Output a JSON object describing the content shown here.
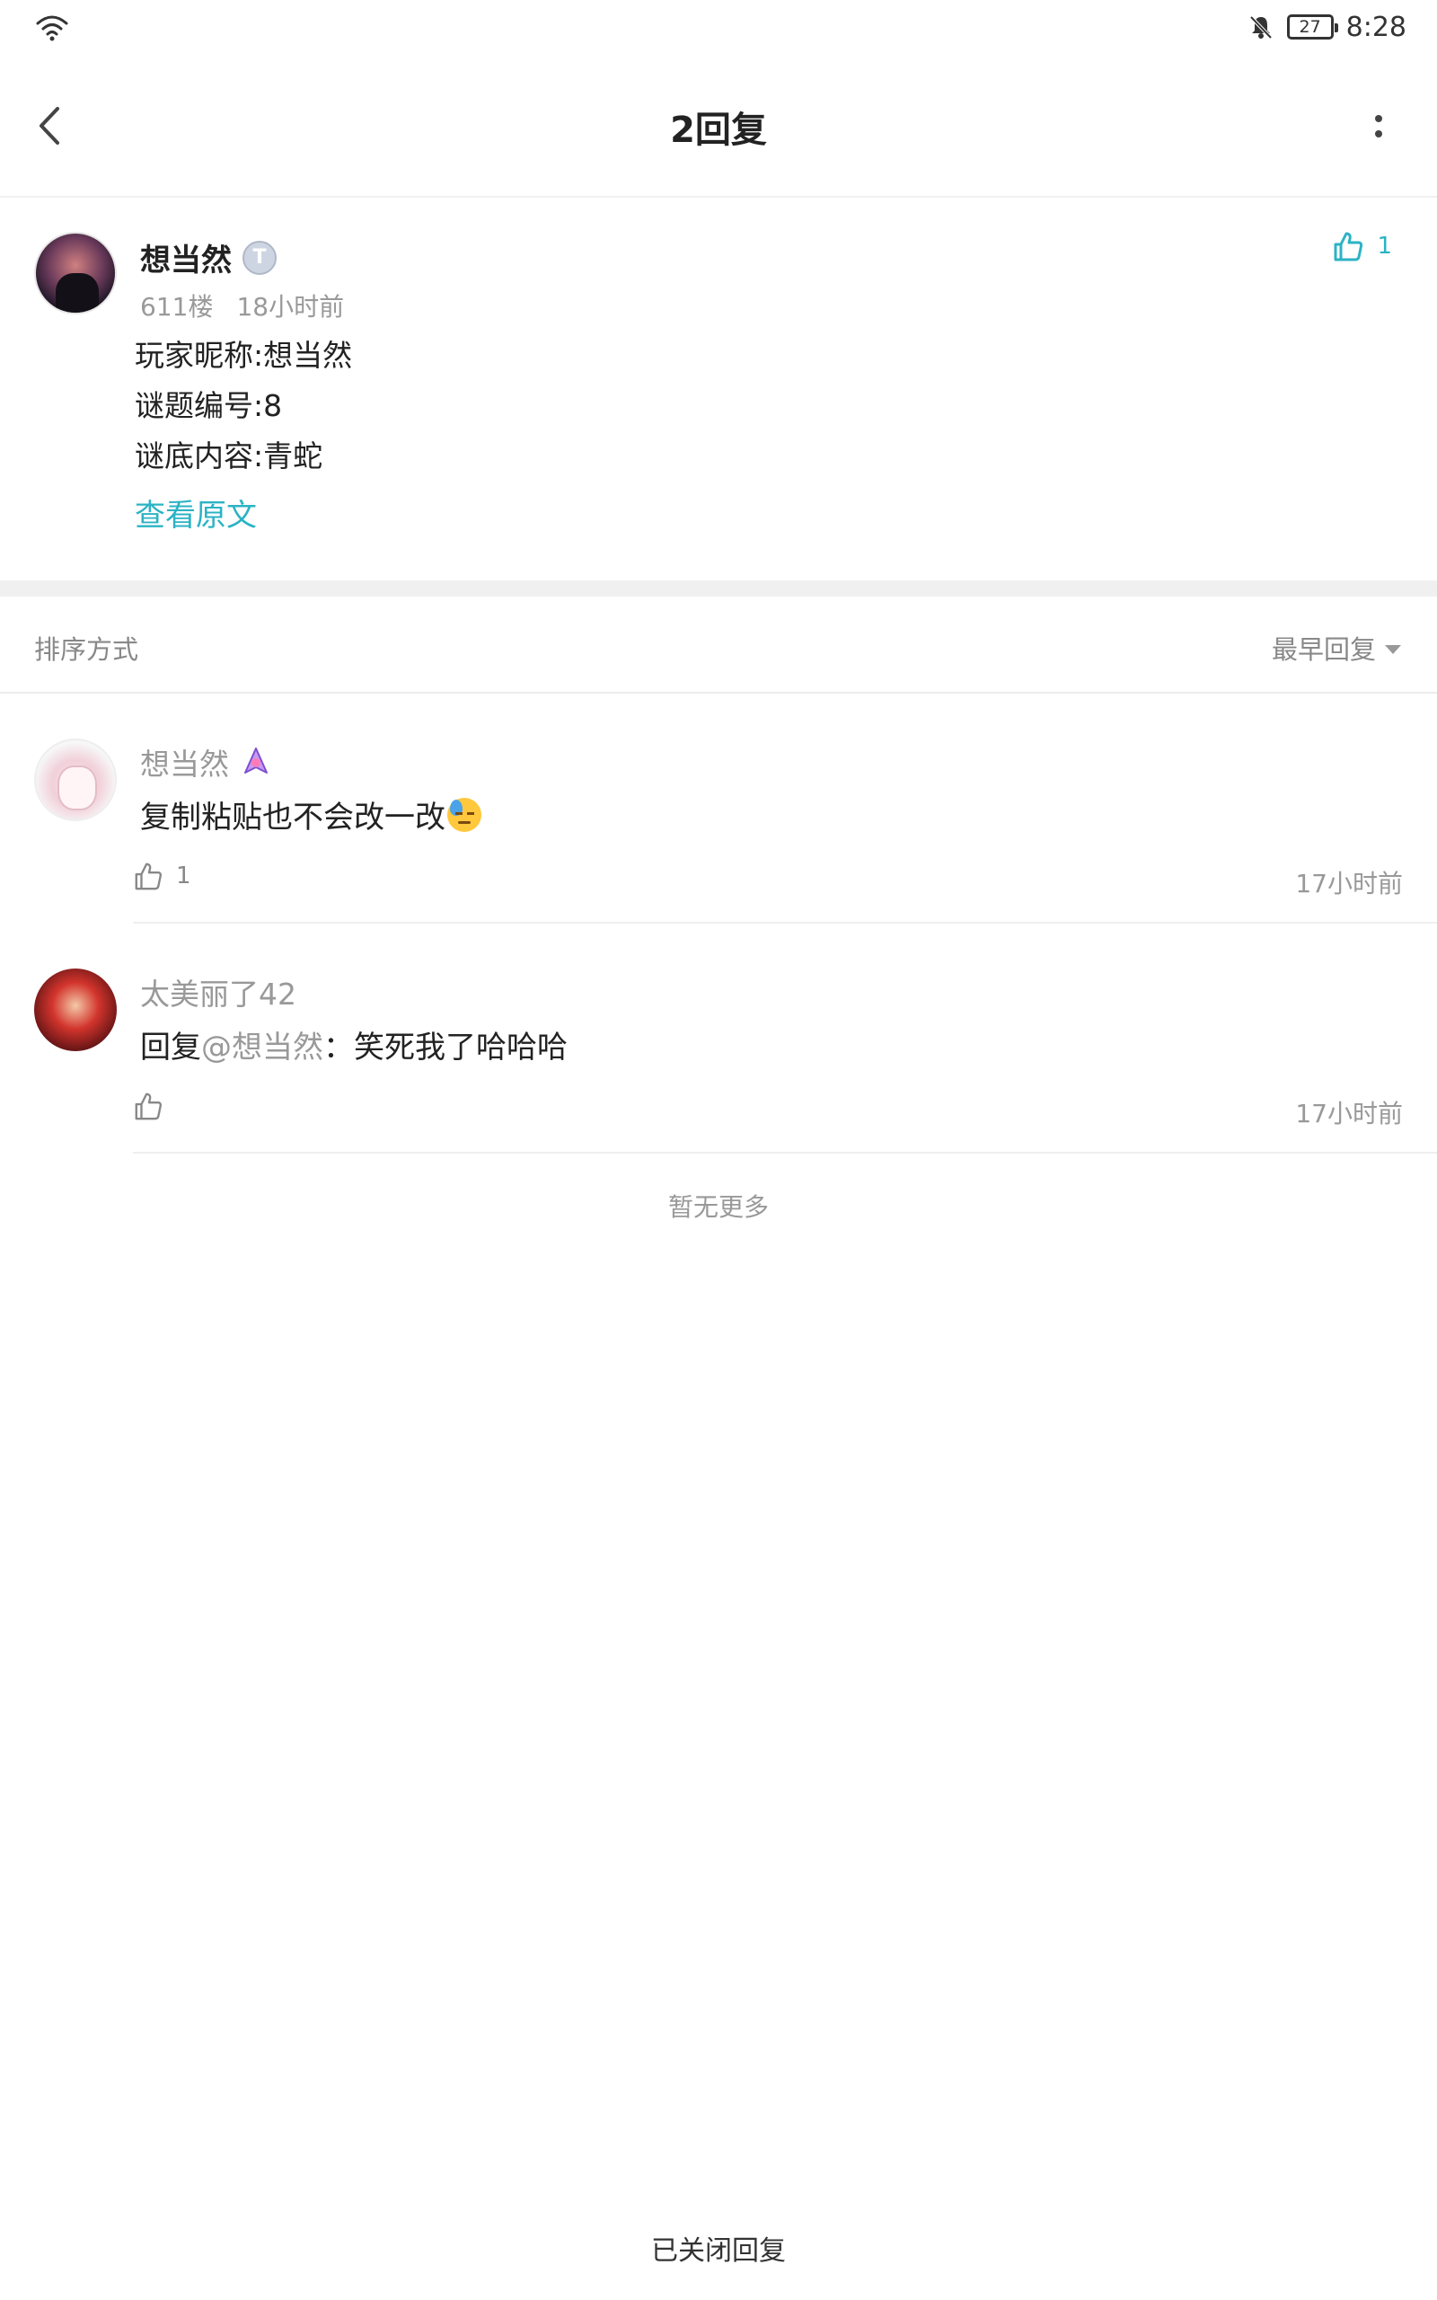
{
  "status_bar": {
    "battery": "27",
    "time": "8:28"
  },
  "header": {
    "title": "2回复"
  },
  "original_post": {
    "author": "想当然",
    "badge": "T",
    "floor": "611楼",
    "time": "18小时前",
    "lines": [
      "玩家昵称:想当然",
      "谜题编号:8",
      "谜底内容:青蛇"
    ],
    "view_original": "查看原文",
    "likes": "1"
  },
  "sort": {
    "label": "排序方式",
    "selected": "最早回复"
  },
  "replies": [
    {
      "author": "想当然",
      "text": "复制粘贴也不会改一改",
      "emoji": "downcast-sweat-emoji",
      "likes": "1",
      "time": "17小时前"
    },
    {
      "author": "太美丽了42",
      "reply_prefix": "回复",
      "mention": "@想当然",
      "text": "：笑死我了哈哈哈",
      "likes": "",
      "time": "17小时前"
    }
  ],
  "footer": {
    "no_more": "暂无更多",
    "closed": "已关闭回复"
  },
  "colors": {
    "accent": "#2bb3c4",
    "secondary_text": "#999999",
    "divider": "#f0f0f0"
  }
}
